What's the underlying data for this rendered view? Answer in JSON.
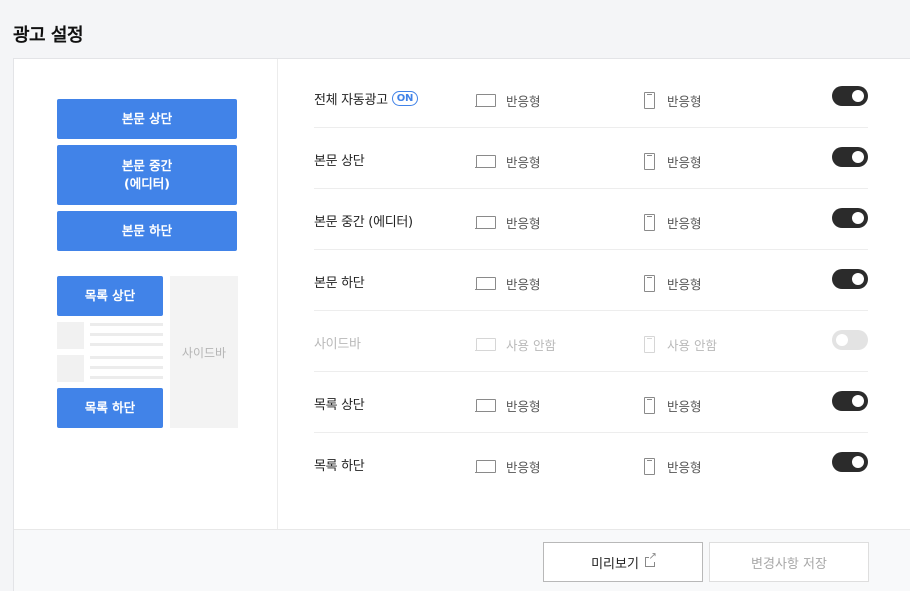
{
  "page_title": "광고 설정",
  "preview": {
    "top_label": "본문 상단",
    "middle_label": "본문 중간\n(에디터)",
    "bottom_label": "본문 하단",
    "list_top_label": "목록 상단",
    "list_bottom_label": "목록 하단",
    "sidebar_label": "사이드바"
  },
  "settings": {
    "rows": [
      {
        "label": "전체 자동광고",
        "badge": "ON",
        "desktop": "반응형",
        "mobile": "반응형",
        "enabled": true
      },
      {
        "label": "본문 상단",
        "desktop": "반응형",
        "mobile": "반응형",
        "enabled": true
      },
      {
        "label": "본문 중간 (에디터)",
        "desktop": "반응형",
        "mobile": "반응형",
        "enabled": true
      },
      {
        "label": "본문 하단",
        "desktop": "반응형",
        "mobile": "반응형",
        "enabled": true
      },
      {
        "label": "사이드바",
        "desktop": "사용 안함",
        "mobile": "사용 안함",
        "enabled": false
      },
      {
        "label": "목록 상단",
        "desktop": "반응형",
        "mobile": "반응형",
        "enabled": true
      },
      {
        "label": "목록 하단",
        "desktop": "반응형",
        "mobile": "반응형",
        "enabled": true
      }
    ]
  },
  "footer": {
    "preview_label": "미리보기",
    "save_label": "변경사항 저장"
  },
  "colors": {
    "accent": "#4183e8",
    "toggle_on": "#2b2b2b",
    "toggle_off": "#e3e3e3"
  }
}
